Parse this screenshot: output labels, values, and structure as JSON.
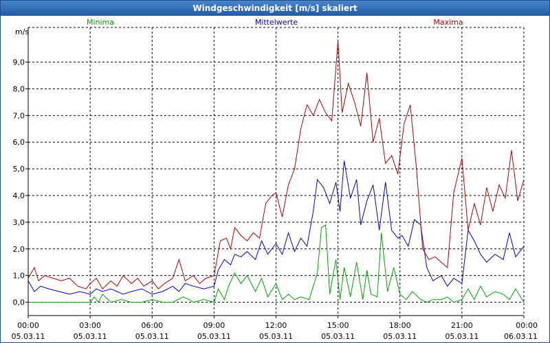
{
  "title": "Windgeschwindigkeit [m/s] skaliert",
  "chart_data": {
    "type": "line",
    "ylabel": "m/s",
    "ylim": [
      -0.5,
      10.3
    ],
    "xlim": [
      0,
      24
    ],
    "y_ticks": [
      "0,0",
      "1,0",
      "2,0",
      "3,0",
      "4,0",
      "5,0",
      "6,0",
      "7,0",
      "8,0",
      "9,0"
    ],
    "y_tick_values": [
      0,
      1,
      2,
      3,
      4,
      5,
      6,
      7,
      8,
      9
    ],
    "x_ticks": [
      {
        "time": "00:00",
        "date": "05.03.11"
      },
      {
        "time": "03:00",
        "date": "05.03.11"
      },
      {
        "time": "06:00",
        "date": "05.03.11"
      },
      {
        "time": "09:00",
        "date": "05.03.11"
      },
      {
        "time": "12:00",
        "date": "05.03.11"
      },
      {
        "time": "15:00",
        "date": "05.03.11"
      },
      {
        "time": "18:00",
        "date": "05.03.11"
      },
      {
        "time": "21:00",
        "date": "05.03.11"
      },
      {
        "time": "00:00",
        "date": "06.03.11"
      }
    ],
    "x_tick_hours": [
      0,
      3,
      6,
      9,
      12,
      15,
      18,
      21,
      24
    ],
    "grid": true,
    "legend_position": "top",
    "series": [
      {
        "name": "Minima",
        "color": "#00a000",
        "x": [
          0,
          0.5,
          1,
          1.5,
          2,
          2.5,
          3,
          3.2,
          3.4,
          3.6,
          4,
          4.5,
          5,
          5.5,
          6,
          6.5,
          7,
          7.5,
          7.8,
          8,
          8.5,
          9,
          9.2,
          9.5,
          9.7,
          10,
          10.3,
          10.6,
          11,
          11.3,
          11.6,
          12,
          12.3,
          12.6,
          12.9,
          13.2,
          13.6,
          14,
          14.2,
          14.4,
          14.6,
          14.9,
          15.1,
          15.3,
          15.6,
          15.9,
          16.2,
          16.4,
          16.6,
          16.9,
          17.1,
          17.4,
          17.7,
          18,
          18.3,
          18.6,
          19,
          19.3,
          19.6,
          20,
          20.3,
          20.6,
          21,
          21.3,
          21.6,
          21.9,
          22.2,
          22.6,
          23,
          23.3,
          23.6,
          24
        ],
        "y": [
          0,
          0,
          0,
          0,
          0,
          0,
          0,
          0.2,
          0,
          0.3,
          0,
          0.1,
          0,
          0,
          0.1,
          0,
          0,
          0.2,
          0.1,
          0,
          0.1,
          0,
          0.5,
          0.1,
          0.6,
          1.1,
          0.7,
          1.0,
          0.4,
          0.9,
          0.2,
          0.7,
          0.1,
          0.3,
          0.1,
          0.2,
          0.1,
          1.1,
          2.8,
          2.9,
          0.3,
          1.6,
          0.1,
          1.3,
          0.2,
          1.5,
          0.1,
          1.2,
          0.3,
          0.2,
          2.6,
          0.4,
          1.3,
          0.3,
          0.1,
          0.4,
          0.1,
          0,
          0.1,
          0.1,
          0.2,
          0,
          0.1,
          0.5,
          0.1,
          0.6,
          0.2,
          0.4,
          0.3,
          0.1,
          0.5,
          0
        ]
      },
      {
        "name": "Mittelwerte",
        "color": "#0000c0",
        "x": [
          0,
          0.3,
          0.6,
          1,
          1.5,
          2,
          2.5,
          3,
          3.3,
          3.6,
          4,
          4.3,
          4.6,
          5,
          5.5,
          6,
          6.5,
          7,
          7.3,
          7.6,
          8,
          8.5,
          9,
          9.2,
          9.5,
          9.8,
          10,
          10.3,
          10.6,
          11,
          11.3,
          11.6,
          12,
          12.3,
          12.6,
          12.9,
          13.2,
          13.5,
          13.8,
          14,
          14.3,
          14.6,
          14.9,
          15.1,
          15.3,
          15.6,
          15.9,
          16.1,
          16.4,
          16.7,
          17,
          17.3,
          17.6,
          17.9,
          18.1,
          18.4,
          18.7,
          19,
          19.3,
          19.6,
          20,
          20.3,
          20.6,
          21,
          21.3,
          21.6,
          21.9,
          22.2,
          22.6,
          23,
          23.3,
          23.6,
          24
        ],
        "y": [
          0.8,
          0.4,
          0.6,
          0.5,
          0.4,
          0.3,
          0.4,
          0.3,
          0.5,
          0.4,
          0.5,
          0.4,
          0.3,
          0.4,
          0.5,
          0.3,
          0.4,
          0.6,
          0.4,
          0.7,
          0.6,
          0.5,
          0.6,
          1.2,
          1.6,
          1.4,
          1.8,
          1.7,
          1.9,
          1.6,
          2.3,
          1.8,
          2.2,
          1.8,
          2.6,
          1.9,
          2.4,
          2.1,
          3.4,
          4.6,
          4.3,
          3.7,
          4.5,
          3.4,
          5.3,
          3.9,
          4.6,
          2.9,
          3.8,
          4.4,
          2.7,
          4.5,
          2.7,
          2.4,
          2.5,
          2.1,
          3.1,
          2.9,
          1.3,
          0.8,
          1.0,
          0.6,
          0.9,
          0.7,
          2.7,
          2.3,
          1.8,
          1.5,
          1.8,
          1.6,
          2.6,
          1.7,
          2.1
        ]
      },
      {
        "name": "Maxima",
        "color": "#b00000",
        "x": [
          0,
          0.3,
          0.5,
          0.8,
          1.2,
          1.6,
          2,
          2.4,
          2.8,
          3,
          3.3,
          3.6,
          4,
          4.3,
          4.6,
          5,
          5.3,
          5.6,
          6,
          6.3,
          6.6,
          7,
          7.3,
          7.6,
          8,
          8.3,
          8.6,
          9,
          9.3,
          9.6,
          9.8,
          10,
          10.3,
          10.6,
          10.9,
          11.2,
          11.5,
          11.8,
          12,
          12.3,
          12.6,
          12.9,
          13.2,
          13.5,
          13.8,
          14.1,
          14.4,
          14.7,
          15,
          15.2,
          15.5,
          15.8,
          16.1,
          16.4,
          16.7,
          17,
          17.3,
          17.6,
          17.9,
          18.2,
          18.5,
          18.8,
          19.1,
          19.4,
          19.7,
          20,
          20.3,
          20.6,
          21,
          21.3,
          21.6,
          21.9,
          22.2,
          22.5,
          22.8,
          23.1,
          23.4,
          23.7,
          24
        ],
        "y": [
          0.9,
          1.3,
          0.8,
          1.0,
          0.9,
          0.8,
          0.9,
          0.6,
          0.5,
          0.7,
          0.9,
          0.5,
          0.8,
          0.6,
          1.0,
          0.7,
          0.9,
          0.6,
          0.8,
          0.5,
          0.7,
          0.9,
          1.6,
          0.8,
          1.0,
          0.7,
          0.9,
          1.0,
          2.3,
          2.4,
          2.0,
          2.8,
          2.5,
          2.3,
          2.6,
          2.4,
          3.7,
          4.0,
          4.1,
          3.2,
          4.4,
          5.0,
          6.5,
          7.4,
          7.0,
          7.6,
          7.1,
          6.8,
          9.8,
          7.1,
          8.2,
          7.5,
          6.6,
          8.6,
          6.0,
          6.9,
          5.2,
          5.5,
          4.8,
          6.7,
          7.4,
          5.0,
          2.0,
          1.6,
          1.7,
          1.5,
          1.3,
          4.1,
          5.4,
          2.7,
          3.7,
          2.9,
          4.3,
          3.4,
          4.4,
          3.9,
          5.7,
          3.8,
          4.6
        ]
      }
    ]
  }
}
